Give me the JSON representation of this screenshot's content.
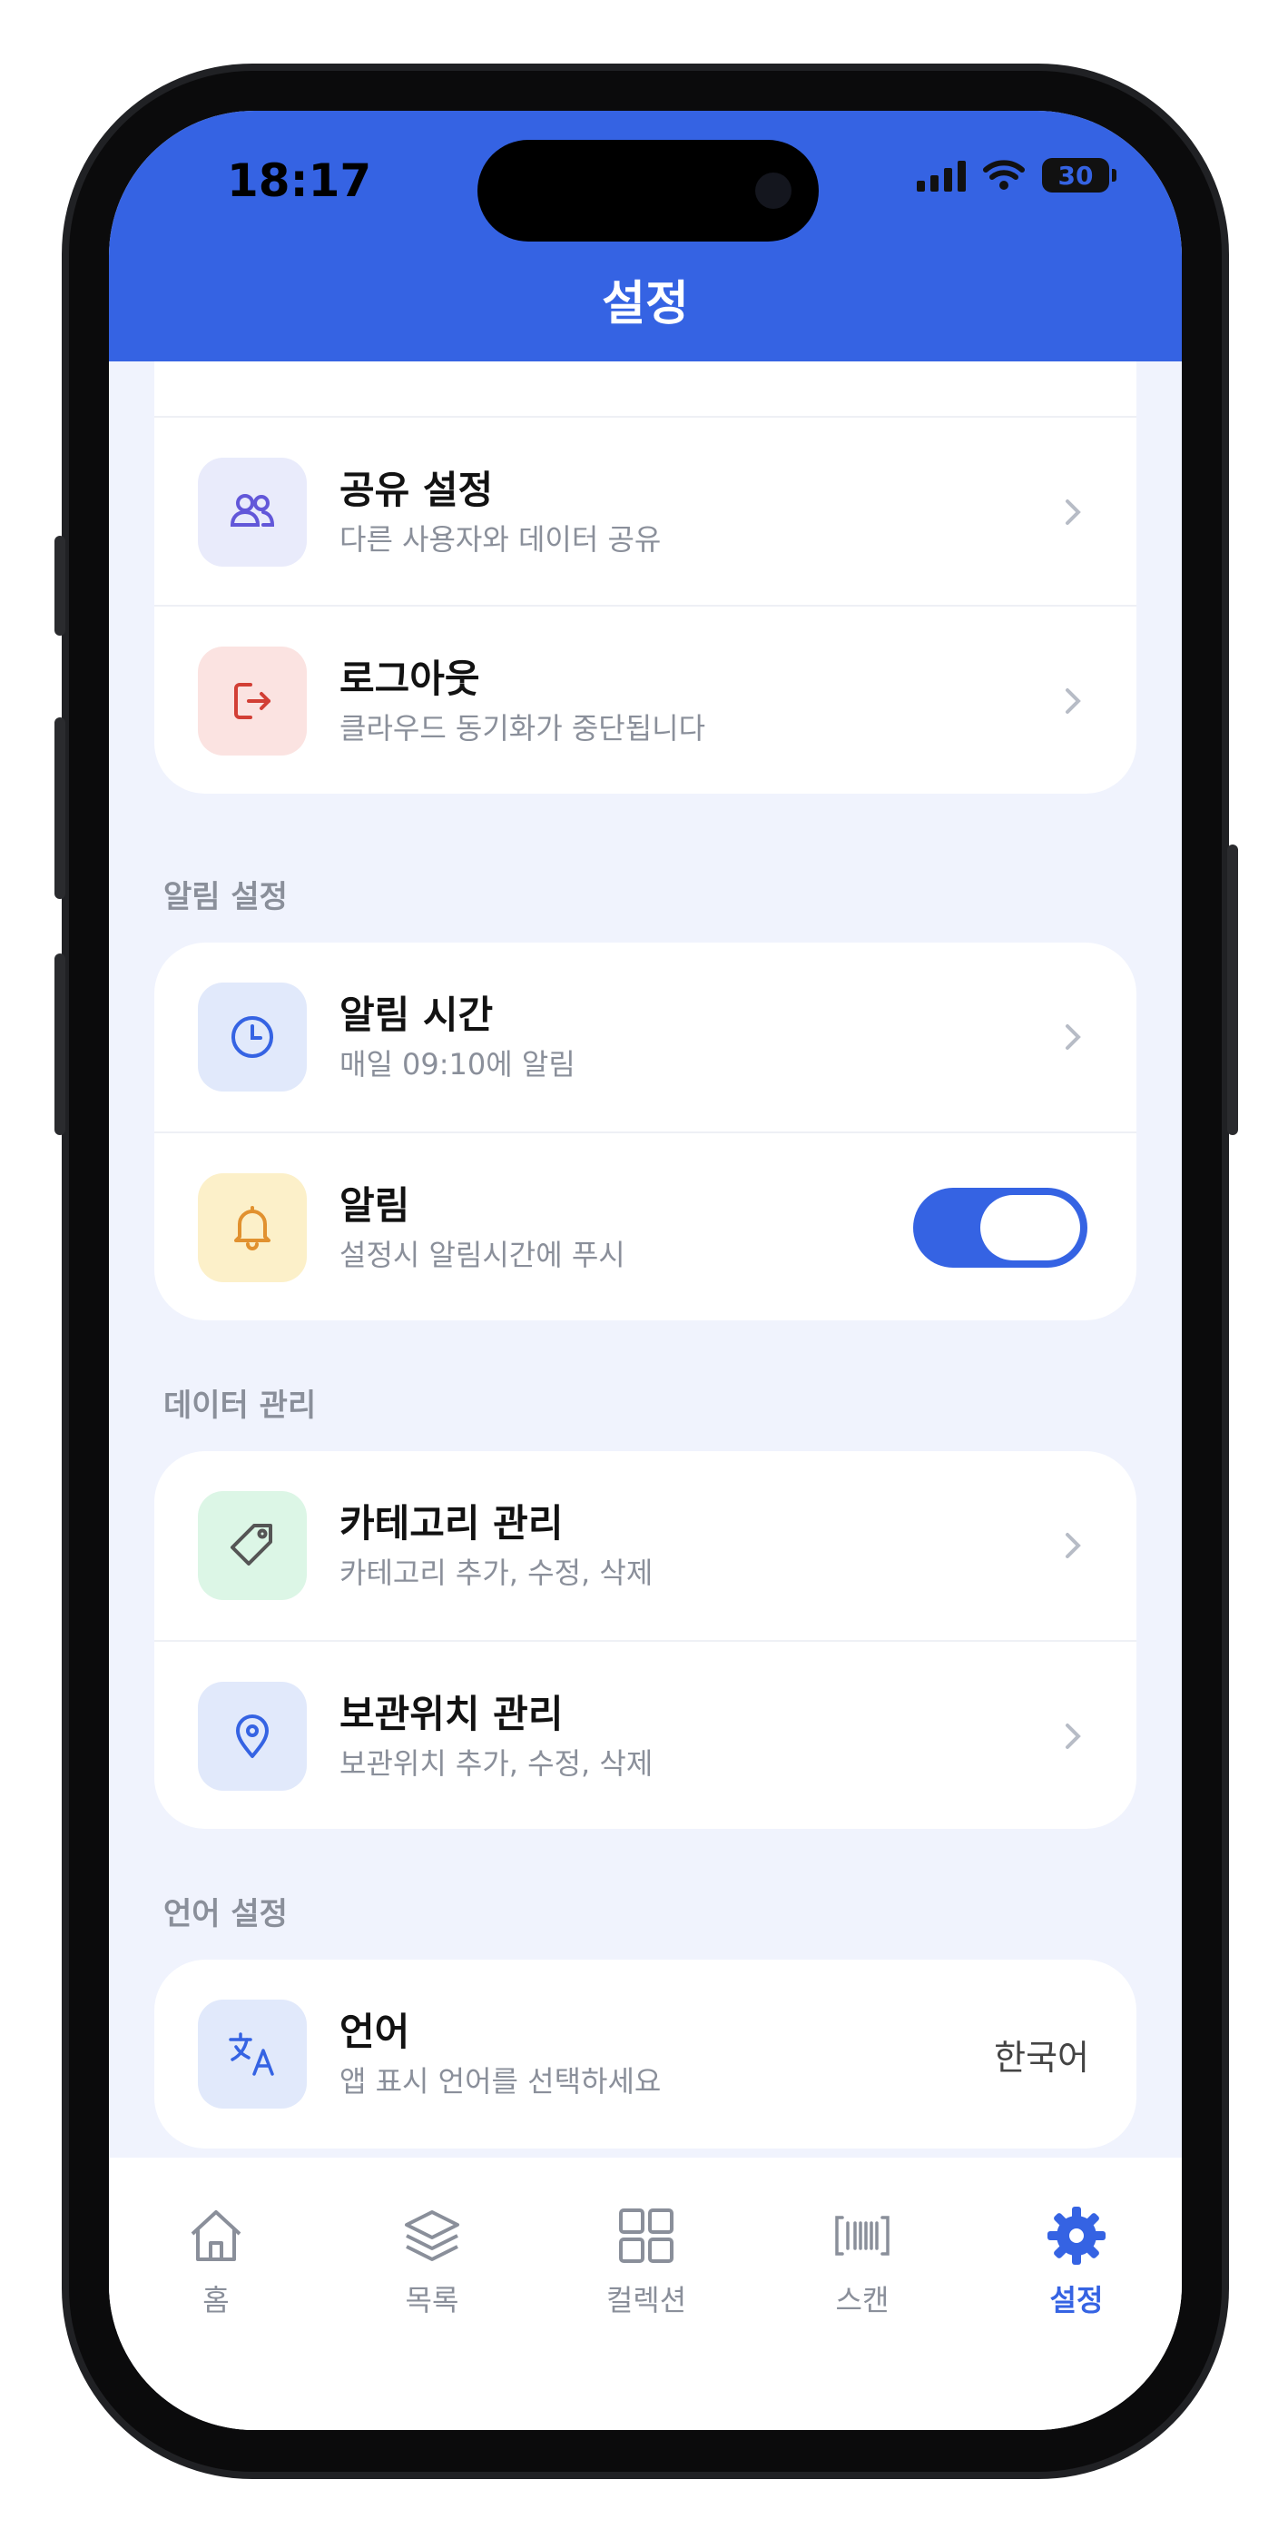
{
  "status_bar": {
    "time": "18:17",
    "battery": "30"
  },
  "header": {
    "title": "설정"
  },
  "account_card": {
    "items": [
      {
        "title": "공유 설정",
        "subtitle": "다른 사용자와 데이터 공유",
        "icon": "users-icon"
      },
      {
        "title": "로그아웃",
        "subtitle": "클라우드 동기화가 중단됩니다",
        "icon": "logout-icon"
      }
    ]
  },
  "notification_section": {
    "label": "알림 설정",
    "items": [
      {
        "title": "알림 시간",
        "subtitle": "매일 09:10에 알림",
        "icon": "clock-icon"
      },
      {
        "title": "알림",
        "subtitle": "설정시 알림시간에 푸시",
        "icon": "bell-icon",
        "toggle_on": true
      }
    ]
  },
  "data_section": {
    "label": "데이터 관리",
    "items": [
      {
        "title": "카테고리 관리",
        "subtitle": "카테고리 추가, 수정, 삭제",
        "icon": "tag-icon"
      },
      {
        "title": "보관위치 관리",
        "subtitle": "보관위치 추가, 수정, 삭제",
        "icon": "location-pin-icon"
      }
    ]
  },
  "language_section": {
    "label": "언어 설정",
    "items": [
      {
        "title": "언어",
        "subtitle": "앱 표시 언어를 선택하세요",
        "value": "한국어",
        "icon": "translate-icon"
      }
    ]
  },
  "tabbar": {
    "active": "설정",
    "items": [
      {
        "label": "홈",
        "icon": "home-icon"
      },
      {
        "label": "목록",
        "icon": "layers-icon"
      },
      {
        "label": "컬렉션",
        "icon": "grid-icon"
      },
      {
        "label": "스캔",
        "icon": "barcode-icon"
      },
      {
        "label": "설정",
        "icon": "gear-icon"
      }
    ]
  },
  "colors": {
    "accent": "#3563e3",
    "background": "#f0f3fd",
    "muted": "#8a8f9a"
  }
}
